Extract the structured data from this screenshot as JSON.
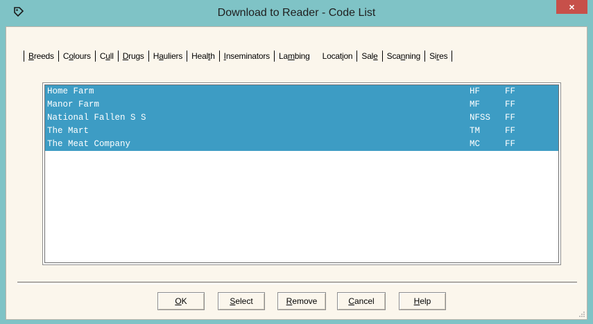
{
  "window": {
    "title": "Download to Reader - Code List",
    "close_label": "×"
  },
  "tabs": [
    {
      "pre": "",
      "u": "B",
      "post": "reeds"
    },
    {
      "pre": "C",
      "u": "o",
      "post": "lours"
    },
    {
      "pre": "C",
      "u": "u",
      "post": "ll"
    },
    {
      "pre": "",
      "u": "D",
      "post": "rugs"
    },
    {
      "pre": "H",
      "u": "a",
      "post": "uliers"
    },
    {
      "pre": "Heal",
      "u": "t",
      "post": "h"
    },
    {
      "pre": "",
      "u": "I",
      "post": "nseminators"
    },
    {
      "pre": "La",
      "u": "m",
      "post": "bing"
    },
    {
      "pre": "Locat",
      "u": "i",
      "post": "on"
    },
    {
      "pre": "Sal",
      "u": "e",
      "post": ""
    },
    {
      "pre": "Sca",
      "u": "n",
      "post": "ning"
    },
    {
      "pre": "Si",
      "u": "r",
      "post": "es"
    }
  ],
  "list": {
    "rows": [
      {
        "name": "Home Farm",
        "code": "HF",
        "type": "FF"
      },
      {
        "name": "Manor Farm",
        "code": "MF",
        "type": "FF"
      },
      {
        "name": "National Fallen S S",
        "code": "NFSS",
        "type": "FF"
      },
      {
        "name": "The Mart",
        "code": "TM",
        "type": "FF"
      },
      {
        "name": "The Meat Company",
        "code": "MC",
        "type": "FF"
      }
    ]
  },
  "buttons": [
    {
      "id": "ok",
      "pre": "",
      "u": "O",
      "post": "K"
    },
    {
      "id": "select",
      "pre": "",
      "u": "S",
      "post": "elect"
    },
    {
      "id": "remove",
      "pre": "",
      "u": "R",
      "post": "emove"
    },
    {
      "id": "cancel",
      "pre": "",
      "u": "C",
      "post": "ancel"
    },
    {
      "id": "help",
      "pre": "",
      "u": "H",
      "post": "elp"
    }
  ],
  "colors": {
    "titlebar": "#7fc3c6",
    "selection": "#3d9cc4",
    "dialog_bg": "#fbf6ec",
    "close": "#c7504a"
  },
  "icons": {
    "app": "tag-icon",
    "close": "close-icon",
    "grip": "resize-grip-icon"
  }
}
